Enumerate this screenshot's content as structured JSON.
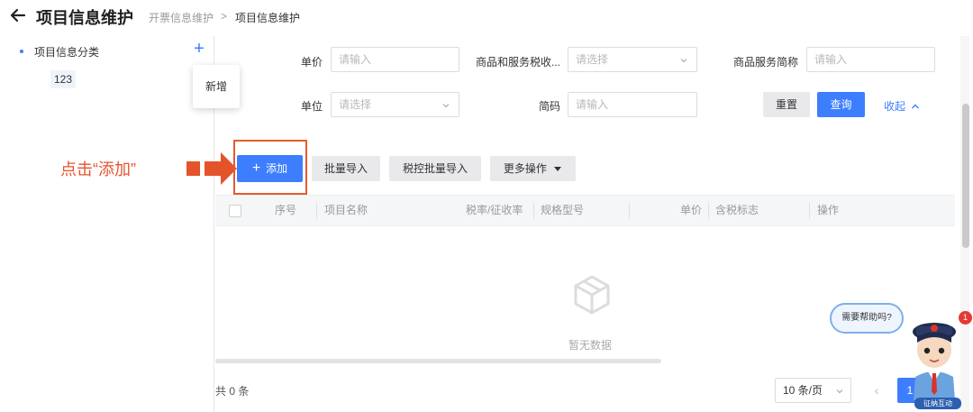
{
  "header": {
    "title": "项目信息维护",
    "breadcrumb": [
      "开票信息维护",
      "项目信息维护"
    ],
    "breadcrumb_separator": ">"
  },
  "sidebar": {
    "root_label": "项目信息分类",
    "add_symbol": "+",
    "child_label": "123",
    "tooltip": "新增"
  },
  "filters": {
    "unit_price": {
      "label": "单价",
      "placeholder": "请输入"
    },
    "tax_class": {
      "label": "商品和服务税收...",
      "placeholder": "请选择"
    },
    "short_name": {
      "label": "商品服务简称",
      "placeholder": "请输入"
    },
    "unit": {
      "label": "单位",
      "placeholder": "请选择"
    },
    "code": {
      "label": "简码",
      "placeholder": "请输入"
    },
    "reset_label": "重置",
    "search_label": "查询",
    "collapse_label": "收起"
  },
  "annotation": {
    "text": "点击“添加”"
  },
  "toolbar": {
    "add_label": "添加",
    "batch_import_label": "批量导入",
    "tax_batch_import_label": "税控批量导入",
    "more_label": "更多操作"
  },
  "table": {
    "columns": [
      "序号",
      "项目名称",
      "税率/征收率",
      "规格型号",
      "单价",
      "含税标志",
      "操作"
    ],
    "empty_text": "暂无数据"
  },
  "footer": {
    "total": "共 0 条",
    "page_size": "10 条/页",
    "prev_symbol": "‹",
    "current_page": "1"
  },
  "help": {
    "bubble": "需要帮助吗?",
    "badge": "1",
    "mascot_label": "征纳互动"
  },
  "colors": {
    "primary": "#3d7eff",
    "annotation": "#e5532b"
  },
  "icons": [
    "back-arrow-icon",
    "chevron-down-icon",
    "chevron-up-icon",
    "caret-down-icon",
    "empty-box-icon",
    "plus-icon"
  ]
}
